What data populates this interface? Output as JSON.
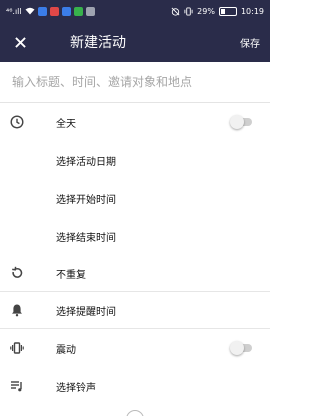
{
  "status_bar": {
    "signal_text": "⁴⁶.ıll",
    "notice_icons": [
      "blue-square-icon",
      "red-square-icon",
      "blue-square-icon",
      "green-square-icon",
      "gray-square-icon"
    ],
    "battery_percent": "29%",
    "battery_level": 0.29,
    "time": "10:19"
  },
  "app_bar": {
    "title": "新建活动",
    "save_label": "保存",
    "background": "#2a2c4a"
  },
  "title_field": {
    "placeholder": "输入标题、时间、邀请对象和地点"
  },
  "rows": {
    "all_day": "全天",
    "select_date": "选择活动日期",
    "select_start": "选择开始时间",
    "select_end": "选择结束时间",
    "repeat": "不重复",
    "reminder": "选择提醒时间",
    "vibrate": "震动",
    "ringtone": "选择铃声"
  },
  "toggles": {
    "all_day_on": false,
    "vibrate_on": false
  }
}
